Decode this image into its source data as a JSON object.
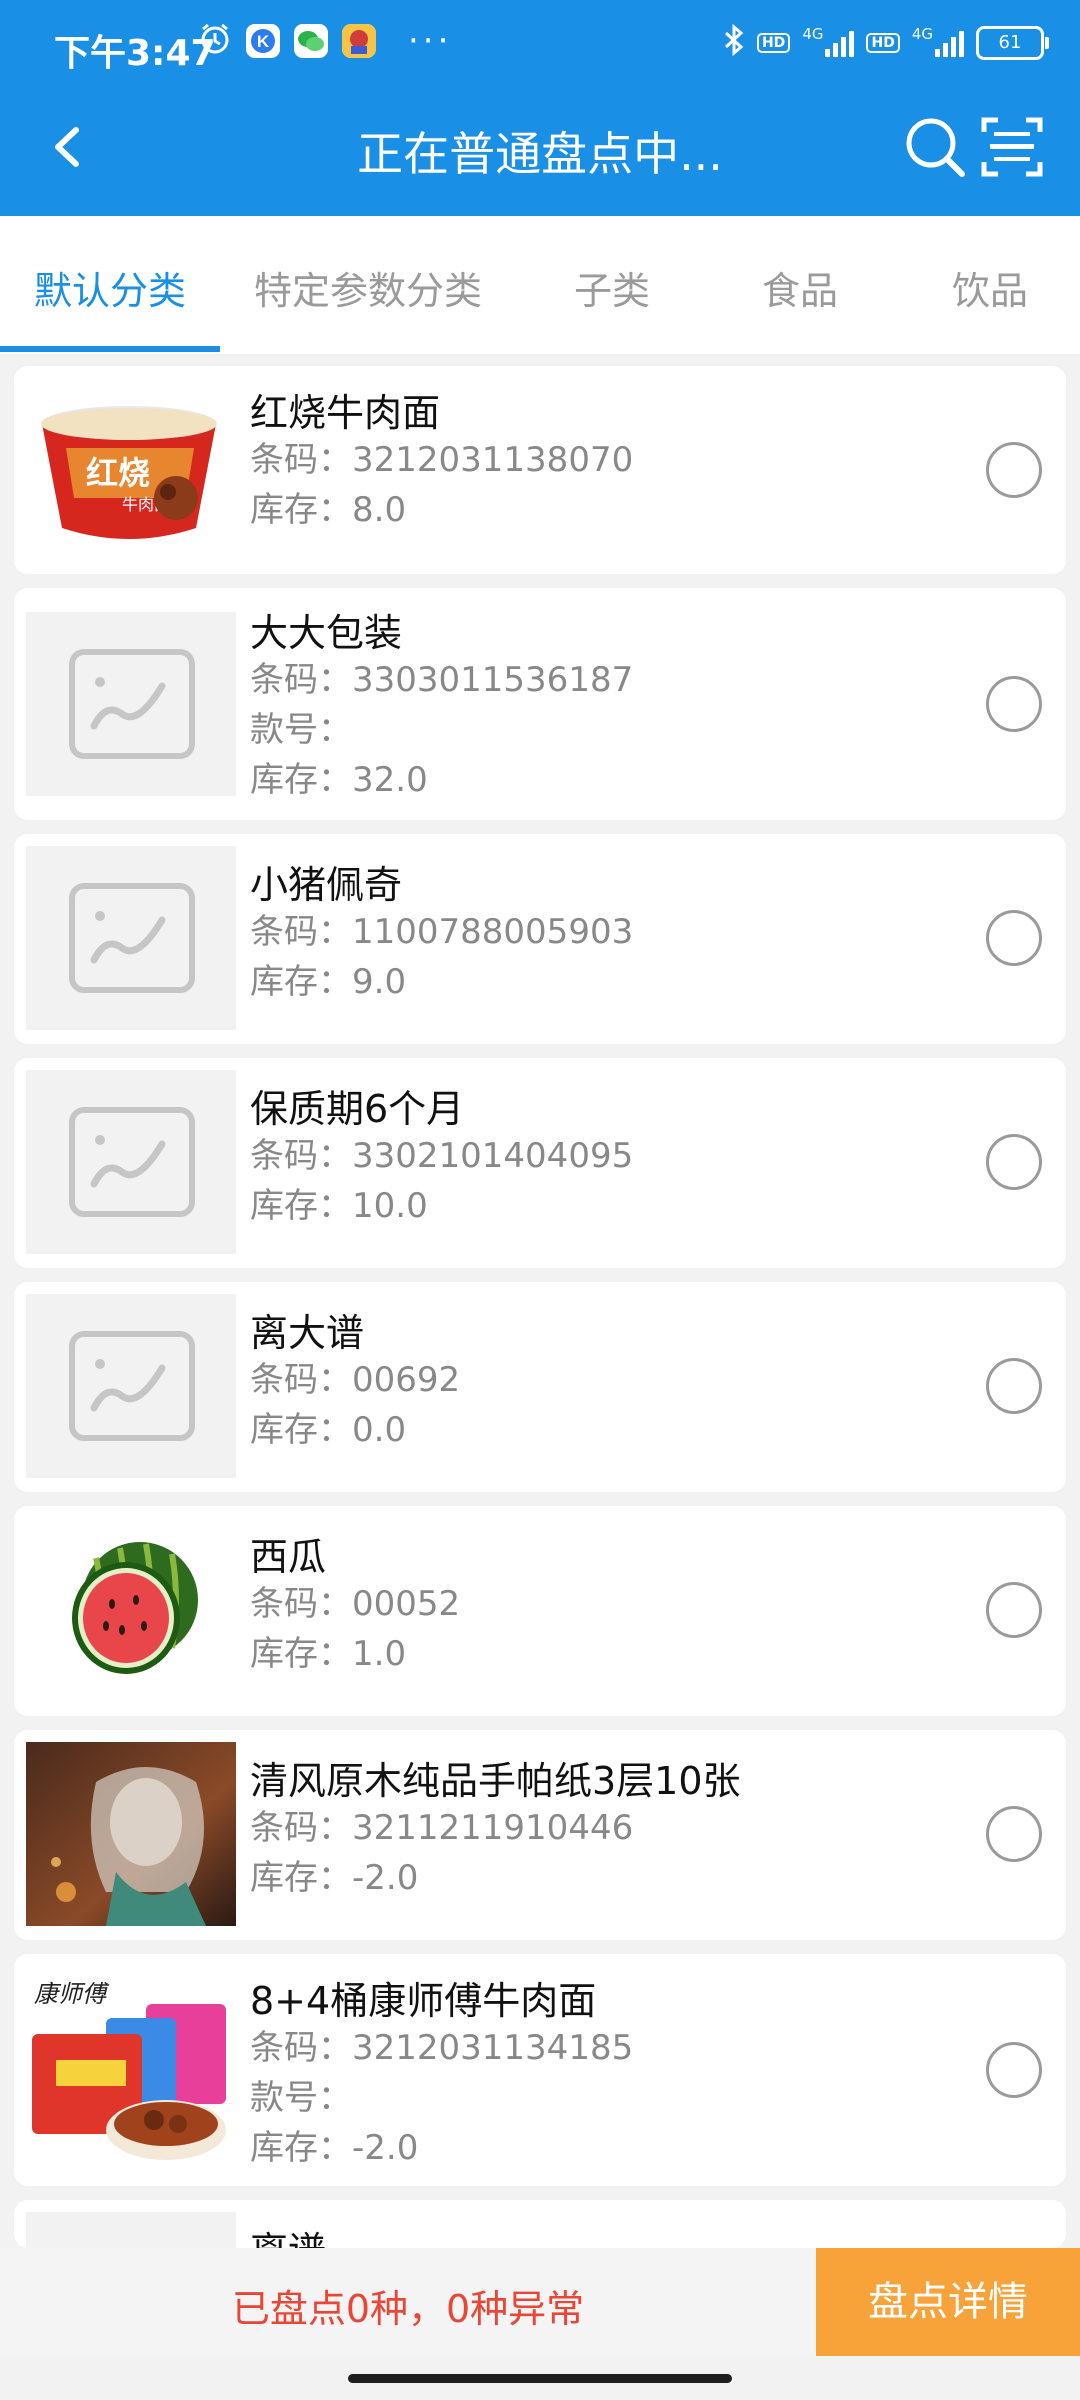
{
  "status_bar": {
    "time": "下午3:47",
    "network_1": "4G",
    "network_2": "4G",
    "hd_1": "HD",
    "hd_2": "HD",
    "battery": "61",
    "more": "···",
    "icons": [
      "alarm-icon",
      "app-k-icon",
      "wechat-icon",
      "game-icon",
      "bluetooth-icon"
    ]
  },
  "header": {
    "title": "正在普通盘点中...",
    "icons": [
      "back-icon",
      "search-icon",
      "scan-icon"
    ],
    "background": "#1a8fe6"
  },
  "tabs": [
    {
      "label": "默认分类",
      "active": true
    },
    {
      "label": "特定参数分类",
      "active": false
    },
    {
      "label": "子类",
      "active": false
    },
    {
      "label": "食品",
      "active": false
    },
    {
      "label": "饮品",
      "active": false
    }
  ],
  "labels": {
    "barcode": "条码：",
    "style": "款号：",
    "stock": "库存："
  },
  "products": [
    {
      "name": "红烧牛肉面",
      "barcode": "3212031138070",
      "stock": "8.0",
      "image": "instant-noodle-bowl"
    },
    {
      "name": "大大包装",
      "barcode": "3303011536187",
      "style_no": "",
      "stock": "32.0",
      "image": "placeholder"
    },
    {
      "name": "小猪佩奇",
      "barcode": "1100788005903",
      "stock": "9.0",
      "image": "placeholder"
    },
    {
      "name": "保质期6个月",
      "barcode": "3302101404095",
      "stock": "10.0",
      "image": "placeholder"
    },
    {
      "name": "离大谱",
      "barcode": "00692",
      "stock": "0.0",
      "image": "placeholder"
    },
    {
      "name": "西瓜",
      "barcode": "00052",
      "stock": "1.0",
      "image": "watermelon"
    },
    {
      "name": "清风原木纯品手帕纸3层10张",
      "barcode": "3211211910446",
      "stock": "-2.0",
      "image": "artwork"
    },
    {
      "name": "8+4桶康师傅牛肉面",
      "barcode": "3212031134185",
      "style_no": "",
      "stock": "-2.0",
      "image": "noodle-pack",
      "brand_text": "康师傅"
    },
    {
      "name": "离谱",
      "image": "placeholder"
    }
  ],
  "footer": {
    "summary": "已盘点0种，0种异常",
    "detail_button": "盘点详情",
    "summary_color": "#ea4535",
    "button_color": "#f8a23a"
  }
}
